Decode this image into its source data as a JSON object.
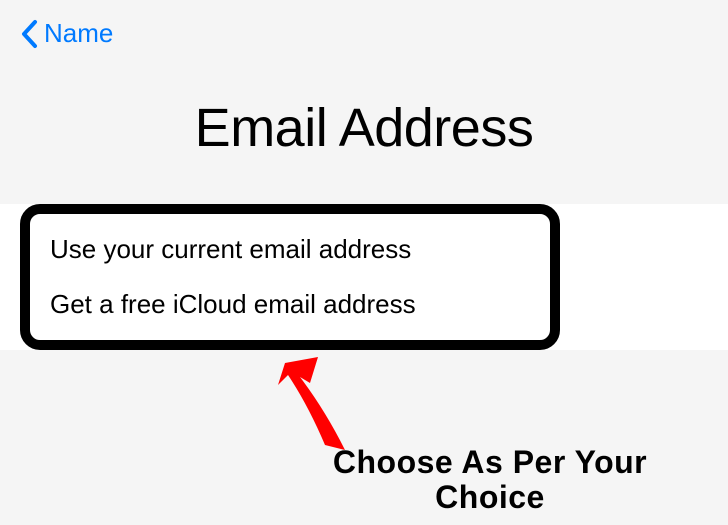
{
  "nav": {
    "back_label": "Name"
  },
  "page": {
    "title": "Email Address"
  },
  "options": [
    {
      "label": "Use your current email address"
    },
    {
      "label": "Get a free iCloud email address"
    }
  ],
  "annotation": {
    "text_line1": "Choose As Per Your",
    "text_line2": "Choice",
    "arrow_color": "#ff0000"
  }
}
